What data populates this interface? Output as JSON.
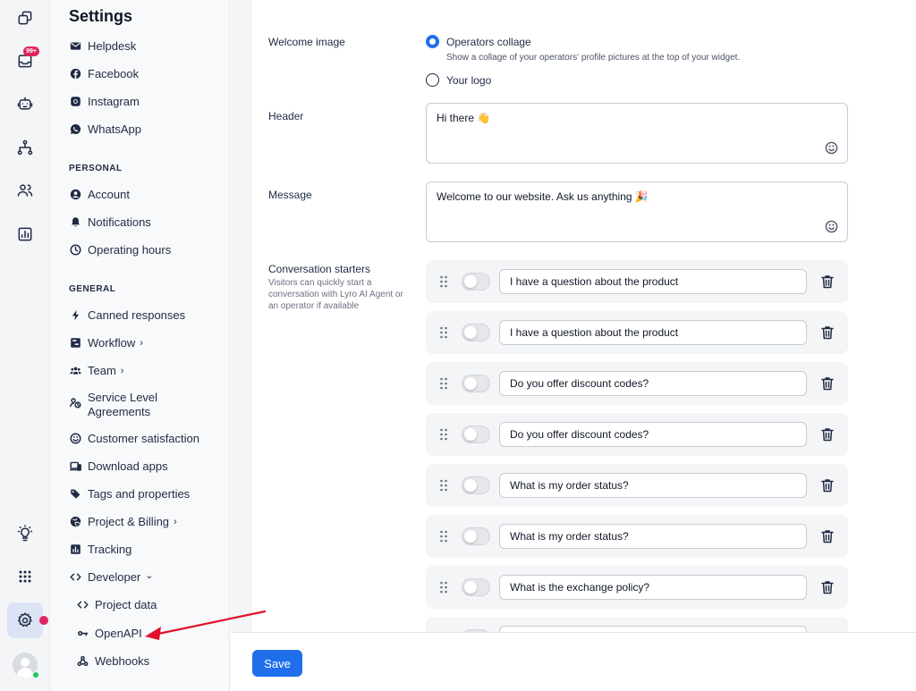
{
  "sidebar": {
    "title": "Settings",
    "channels": [
      {
        "label": "Helpdesk",
        "icon": "envelope-icon"
      },
      {
        "label": "Facebook",
        "icon": "facebook-icon"
      },
      {
        "label": "Instagram",
        "icon": "instagram-icon"
      },
      {
        "label": "WhatsApp",
        "icon": "whatsapp-icon"
      }
    ],
    "personal_label": "PERSONAL",
    "personal": [
      {
        "label": "Account",
        "icon": "user-icon"
      },
      {
        "label": "Notifications",
        "icon": "bell-icon"
      },
      {
        "label": "Operating hours",
        "icon": "clock-icon"
      }
    ],
    "general_label": "GENERAL",
    "general": [
      {
        "label": "Canned responses",
        "icon": "bolt-icon"
      },
      {
        "label": "Workflow",
        "icon": "workflow-icon",
        "chevron": "›"
      },
      {
        "label": "Team",
        "icon": "team-icon",
        "chevron": "›"
      },
      {
        "label": "Service Level",
        "label2": "Agreements",
        "icon": "sla-icon"
      },
      {
        "label": "Customer satisfaction",
        "icon": "smile-icon"
      },
      {
        "label": "Download apps",
        "icon": "devices-icon"
      },
      {
        "label": "Tags and properties",
        "icon": "tag-icon"
      },
      {
        "label": "Project & Billing",
        "icon": "globe-icon",
        "chevron": "›"
      },
      {
        "label": "Tracking",
        "icon": "chart-icon"
      },
      {
        "label": "Developer",
        "icon": "code-icon",
        "chevron": "⌄"
      }
    ],
    "developer": [
      {
        "label": "Project data",
        "icon": "code-icon"
      },
      {
        "label": "OpenAPI",
        "icon": "key-icon"
      },
      {
        "label": "Webhooks",
        "icon": "webhook-icon"
      }
    ]
  },
  "rail": {
    "inbox_badge": "99+"
  },
  "form": {
    "welcome_image": {
      "label": "Welcome image",
      "option1": "Operators collage",
      "option1_help": "Show a collage of your operators' profile pictures at the top of your widget.",
      "option2": "Your logo",
      "selected": "Operators collage"
    },
    "header": {
      "label": "Header",
      "value": "Hi there 👋"
    },
    "message": {
      "label": "Message",
      "value": "Welcome to our website. Ask us anything 🎉"
    },
    "starters": {
      "label": "Conversation starters",
      "help": "Visitors can quickly start a conversation with Lyro AI Agent or an operator if available",
      "items": [
        {
          "text": "I have a question about the product",
          "enabled": false
        },
        {
          "text": "I have a question about the product",
          "enabled": false
        },
        {
          "text": "Do you offer discount codes?",
          "enabled": false
        },
        {
          "text": "Do you offer discount codes?",
          "enabled": false
        },
        {
          "text": "What is my order status?",
          "enabled": false
        },
        {
          "text": "What is my order status?",
          "enabled": false
        },
        {
          "text": "What is the exchange policy?",
          "enabled": false
        },
        {
          "text": "",
          "enabled": false
        }
      ]
    }
  },
  "footer": {
    "save_label": "Save"
  },
  "colors": {
    "accent": "#1f6feb",
    "annotation_arrow": "#e0112b",
    "notification_dot": "#e0245e",
    "online_status": "#22c55e"
  }
}
